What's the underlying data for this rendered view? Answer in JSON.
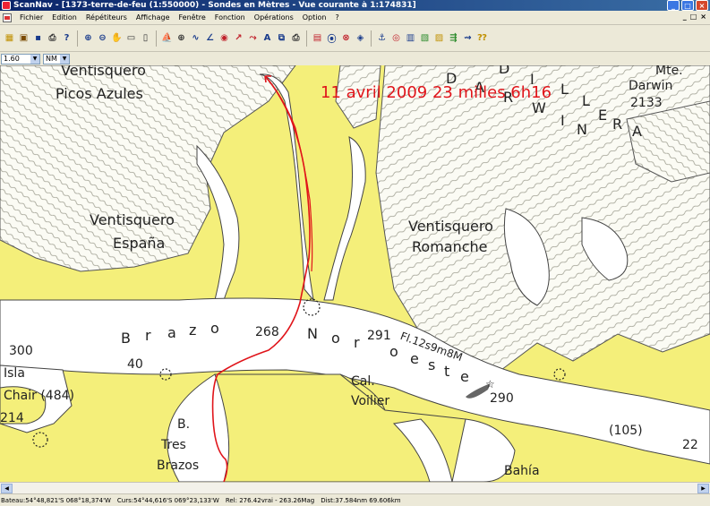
{
  "window": {
    "title": "ScanNav - [1373-terre-de-feu (1:550000) - Sondes en Mètres - Vue courante à 1:174831]",
    "controls": [
      "_",
      "□",
      "×"
    ]
  },
  "menu": {
    "items": [
      "Fichier",
      "Edition",
      "Répétiteurs",
      "Affichage",
      "Fenêtre",
      "Fonction",
      "Opérations",
      "Option",
      "?"
    ],
    "mdi_controls": [
      "_",
      "□",
      "×"
    ]
  },
  "toolbar": {
    "icons": [
      {
        "name": "route-icon",
        "glyph": "▦",
        "color": "#c09000"
      },
      {
        "name": "print-setup-icon",
        "glyph": "▣",
        "color": "#7a4a00"
      },
      {
        "name": "save-icon",
        "glyph": "▪",
        "color": "#1a3c8c"
      },
      {
        "name": "print-icon",
        "glyph": "⎙",
        "color": "#333333"
      },
      {
        "name": "help-icon",
        "glyph": "?",
        "color": "#1a3c8c"
      },
      {
        "name": "zoom-in-icon",
        "glyph": "⊕",
        "color": "#1a3c8c"
      },
      {
        "name": "zoom-out-icon",
        "glyph": "⊖",
        "color": "#1a3c8c"
      },
      {
        "name": "hand-icon",
        "glyph": "✋",
        "color": "#333333"
      },
      {
        "name": "select-rect-icon",
        "glyph": "▭",
        "color": "#333333"
      },
      {
        "name": "window-icon",
        "glyph": "▯",
        "color": "#333333"
      },
      {
        "name": "boat-icon",
        "glyph": "⛵",
        "color": "#c0202a"
      },
      {
        "name": "crosshair-icon",
        "glyph": "⊕",
        "color": "#333333"
      },
      {
        "name": "curve-icon",
        "glyph": "∿",
        "color": "#1a3c8c"
      },
      {
        "name": "measure-icon",
        "glyph": "∠",
        "color": "#1a3c8c"
      },
      {
        "name": "mark-icon",
        "glyph": "◉",
        "color": "#c0202a"
      },
      {
        "name": "track-icon",
        "glyph": "↗",
        "color": "#c0202a"
      },
      {
        "name": "route-edit-icon",
        "glyph": "⤳",
        "color": "#c0202a"
      },
      {
        "name": "text-icon",
        "glyph": "A",
        "color": "#1a3c8c"
      },
      {
        "name": "layers-icon",
        "glyph": "⧉",
        "color": "#1a3c8c"
      },
      {
        "name": "printer-icon",
        "glyph": "⎙",
        "color": "#333333"
      },
      {
        "name": "gps-nmea-icon",
        "glyph": "▤",
        "color": "#c0202a"
      },
      {
        "name": "compass-icon",
        "glyph": "⦿",
        "color": "#1a3c8c"
      },
      {
        "name": "target-icon",
        "glyph": "⊗",
        "color": "#c0202a"
      },
      {
        "name": "ais-icon",
        "glyph": "◈",
        "color": "#1a3c8c"
      },
      {
        "name": "anchor-icon",
        "glyph": "⚓",
        "color": "#1a3c8c"
      },
      {
        "name": "alarm-icon",
        "glyph": "◎",
        "color": "#c0202a"
      },
      {
        "name": "tide-icon",
        "glyph": "▥",
        "color": "#1a3c8c"
      },
      {
        "name": "weather-icon",
        "glyph": "▧",
        "color": "#2a8a2a"
      },
      {
        "name": "grib-icon",
        "glyph": "▨",
        "color": "#c09000"
      },
      {
        "name": "wind-icon",
        "glyph": "⇶",
        "color": "#2a8a2a"
      },
      {
        "name": "current-icon",
        "glyph": "⇝",
        "color": "#1a3c8c"
      },
      {
        "name": "setup-help-icon",
        "glyph": "⁇",
        "color": "#c09000"
      }
    ]
  },
  "scale": {
    "value": "1.60",
    "unit": "NM"
  },
  "map": {
    "annotation": "11 avril 2009 23 milles 6h16",
    "labels": [
      "Ventisquero",
      "Picos Azules",
      "Ventisquero",
      "España",
      "Ventisquero",
      "Romanche",
      "Mte.",
      "Darwin",
      "2133",
      "D",
      "I",
      "L",
      "L",
      "E",
      "R",
      "A",
      "D",
      "A",
      "R",
      "W",
      "I",
      "N",
      "B",
      "r",
      "a",
      "z",
      "o",
      "N",
      "o",
      "r",
      "o",
      "e",
      "s",
      "t",
      "e",
      "268",
      "291",
      "300",
      "40",
      "290",
      "(105)",
      "22",
      "Isla",
      "Chair (484)",
      "214",
      "Cal.",
      "Voilier",
      "B.",
      "Tres",
      "Brazos",
      "Bahía",
      "Fl.12s9m8M"
    ]
  },
  "status": {
    "bateau": "Bateau:54°48,821'S 068°18,374'W",
    "curseur": "Curs:54°44,616'S 069°23,133'W",
    "relevement": "Rel: 276.42vrai - 263.26Mag",
    "distance": "Dist:37.584nm  69.606km"
  },
  "colors": {
    "land": "#f4ef7a",
    "glacier": "#ffffff",
    "water": "#ffffff",
    "track": "#e0141a",
    "titlebar": "#0a246a"
  }
}
